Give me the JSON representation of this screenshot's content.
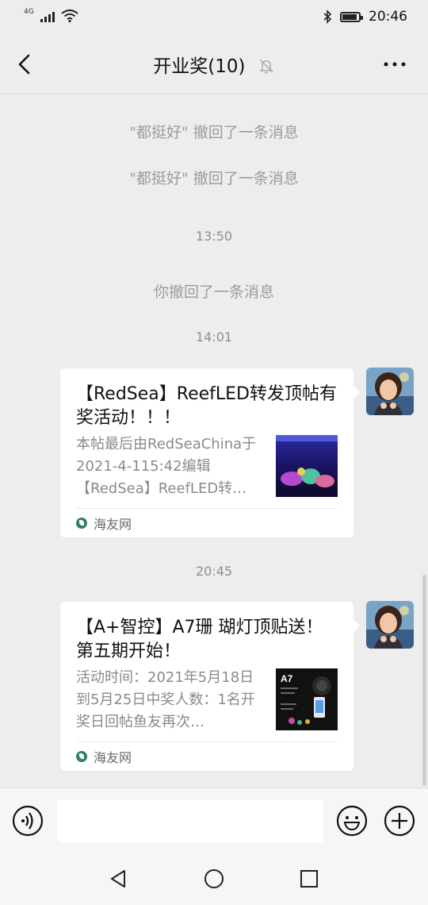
{
  "status_bar": {
    "network": "4G",
    "time": "20:46",
    "icons": [
      "signal-icon",
      "wifi-icon",
      "bluetooth-icon",
      "battery-icon"
    ]
  },
  "header": {
    "title": "开业奖(10)",
    "icons": [
      "back-icon",
      "mute-bell-icon",
      "more-icon"
    ]
  },
  "messages": {
    "recall_1": "\"都挺好\" 撤回了一条消息",
    "recall_2": "\"都挺好\" 撤回了一条消息",
    "time_1": "13:50",
    "recall_3": "你撤回了一条消息",
    "time_2": "14:01",
    "card_1": {
      "title": "【RedSea】ReefLED转发顶帖有奖活动！！！",
      "desc": "本帖最后由RedSeaChina于2021-4-115:42编辑【RedSea】ReefLED转…",
      "source": "海友网"
    },
    "time_3": "20:45",
    "card_2": {
      "title": "【A+智控】A7珊 瑚灯顶贴送！第五期开始！",
      "desc": "活动时间：2021年5月18日到5月25日中奖人数：1名开奖日回帖鱼友再次…",
      "thumb_label": "A7",
      "source": "海友网"
    }
  },
  "input_bar": {
    "placeholder": "",
    "icons": [
      "voice-icon",
      "emoji-icon",
      "plus-icon"
    ]
  },
  "colors": {
    "background": "#ededed",
    "card": "#ffffff",
    "system_text": "#9c9c9c",
    "source_icon": "#2f7f6f"
  }
}
